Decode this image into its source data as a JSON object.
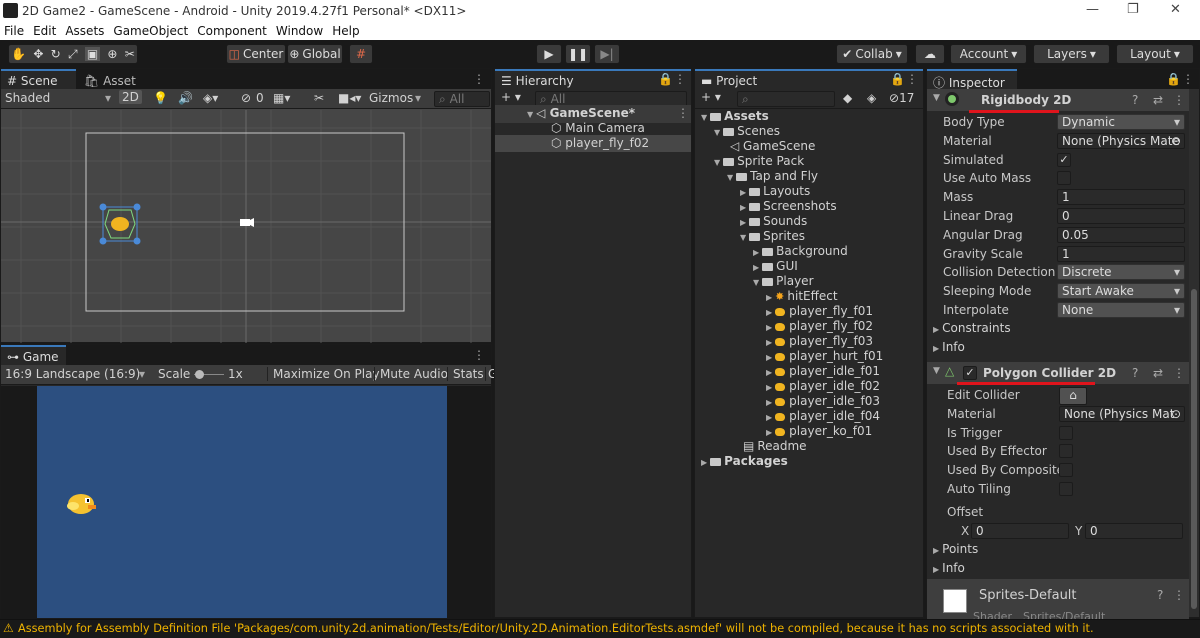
{
  "window": {
    "title": "2D Game2 - GameScene - Android - Unity 2019.4.27f1 Personal* <DX11>",
    "min": "—",
    "max": "❐",
    "close": "✕"
  },
  "menu": [
    "File",
    "Edit",
    "Assets",
    "GameObject",
    "Component",
    "Window",
    "Help"
  ],
  "toolbar": {
    "center": "Center",
    "global": "Global",
    "collab": "Collab",
    "account": "Account",
    "layers": "Layers",
    "layout": "Layout"
  },
  "scene": {
    "tab": "Scene",
    "asset_store_tab": "Asset Store",
    "shading": "Shaded",
    "mode2d": "2D",
    "hidden_count": "0",
    "gizmos": "Gizmos",
    "search_placeholder": "All"
  },
  "game": {
    "tab": "Game",
    "aspect": "16:9 Landscape (16:9)",
    "scale_label": "Scale",
    "scale_value": "1x",
    "maximize": "Maximize On Play",
    "mute": "Mute Audio",
    "stats": "Stats",
    "gizmos_clip": "G"
  },
  "hierarchy": {
    "tab": "Hierarchy",
    "search_placeholder": "All",
    "scene": "GameScene*",
    "items": [
      "Main Camera",
      "player_fly_f02"
    ]
  },
  "project": {
    "tab": "Project",
    "count": "17",
    "tree": [
      {
        "label": "Assets",
        "kind": "folder",
        "bold": true,
        "fold": "▼"
      },
      {
        "label": "Scenes",
        "kind": "folder",
        "fold": "▼"
      },
      {
        "label": "GameScene",
        "kind": "scene",
        "fold": ""
      },
      {
        "label": "Sprite Pack",
        "kind": "folder",
        "fold": "▼"
      },
      {
        "label": "Tap and Fly",
        "kind": "folder",
        "fold": "▼"
      },
      {
        "label": "Layouts",
        "kind": "folder",
        "fold": "▶"
      },
      {
        "label": "Screenshots",
        "kind": "folder",
        "fold": "▶"
      },
      {
        "label": "Sounds",
        "kind": "folder",
        "fold": "▶"
      },
      {
        "label": "Sprites",
        "kind": "folder",
        "fold": "▼"
      },
      {
        "label": "Background",
        "kind": "folder",
        "fold": "▶"
      },
      {
        "label": "GUI",
        "kind": "folder",
        "fold": "▶"
      },
      {
        "label": "Player",
        "kind": "folder",
        "fold": "▼"
      },
      {
        "label": "hitEffect",
        "kind": "fx",
        "fold": "▶"
      },
      {
        "label": "player_fly_f01",
        "kind": "sprite",
        "fold": "▶"
      },
      {
        "label": "player_fly_f02",
        "kind": "sprite",
        "fold": "▶"
      },
      {
        "label": "player_fly_f03",
        "kind": "sprite",
        "fold": "▶"
      },
      {
        "label": "player_hurt_f01",
        "kind": "sprite",
        "fold": "▶"
      },
      {
        "label": "player_idle_f01",
        "kind": "sprite",
        "fold": "▶"
      },
      {
        "label": "player_idle_f02",
        "kind": "sprite",
        "fold": "▶"
      },
      {
        "label": "player_idle_f03",
        "kind": "sprite",
        "fold": "▶"
      },
      {
        "label": "player_idle_f04",
        "kind": "sprite",
        "fold": "▶"
      },
      {
        "label": "player_ko_f01",
        "kind": "sprite",
        "fold": "▶"
      },
      {
        "label": "Readme",
        "kind": "doc",
        "fold": ""
      },
      {
        "label": "Packages",
        "kind": "folder",
        "bold": true,
        "fold": "▶"
      }
    ]
  },
  "inspector": {
    "tab": "Inspector",
    "rigidbody": {
      "title": "Rigidbody 2D",
      "rows": [
        {
          "label": "Body Type",
          "value": "Dynamic",
          "type": "drop"
        },
        {
          "label": "Material",
          "value": "None (Physics Mate",
          "type": "obj"
        },
        {
          "label": "Simulated",
          "value": "✓",
          "type": "check"
        },
        {
          "label": "Use Auto Mass",
          "value": "",
          "type": "check"
        },
        {
          "label": "Mass",
          "value": "1",
          "type": "field"
        },
        {
          "label": "Linear Drag",
          "value": "0",
          "type": "field"
        },
        {
          "label": "Angular Drag",
          "value": "0.05",
          "type": "field"
        },
        {
          "label": "Gravity Scale",
          "value": "1",
          "type": "field"
        },
        {
          "label": "Collision Detection",
          "value": "Discrete",
          "type": "drop"
        },
        {
          "label": "Sleeping Mode",
          "value": "Start Awake",
          "type": "drop"
        },
        {
          "label": "Interpolate",
          "value": "None",
          "type": "drop"
        }
      ],
      "constraints": "Constraints",
      "info": "Info"
    },
    "collider": {
      "title": "Polygon Collider 2D",
      "rows": [
        {
          "label": "Edit Collider",
          "value": "",
          "type": "button"
        },
        {
          "label": "Material",
          "value": "None (Physics Mat",
          "type": "obj"
        },
        {
          "label": "Is Trigger",
          "value": "",
          "type": "check"
        },
        {
          "label": "Used By Effector",
          "value": "",
          "type": "check"
        },
        {
          "label": "Used By Composite",
          "value": "",
          "type": "check"
        },
        {
          "label": "Auto Tiling",
          "value": "",
          "type": "check"
        }
      ],
      "offset": "Offset",
      "x_label": "X",
      "x": "0",
      "y_label": "Y",
      "y": "0",
      "points": "Points",
      "info": "Info"
    },
    "material": {
      "name": "Sprites-Default",
      "shader_label": "Shader",
      "shader": "Sprites/Default"
    }
  },
  "status": "Assembly for Assembly Definition File 'Packages/com.unity.2d.animation/Tests/Editor/Unity.2D.Animation.EditorTests.asmdef' will not be compiled, because it has no scripts associated with it.",
  "colors": {
    "accent": "#3a79bb",
    "annotation": "#e0141c",
    "game_bg": "#2c4f80",
    "selected": "#474747"
  }
}
